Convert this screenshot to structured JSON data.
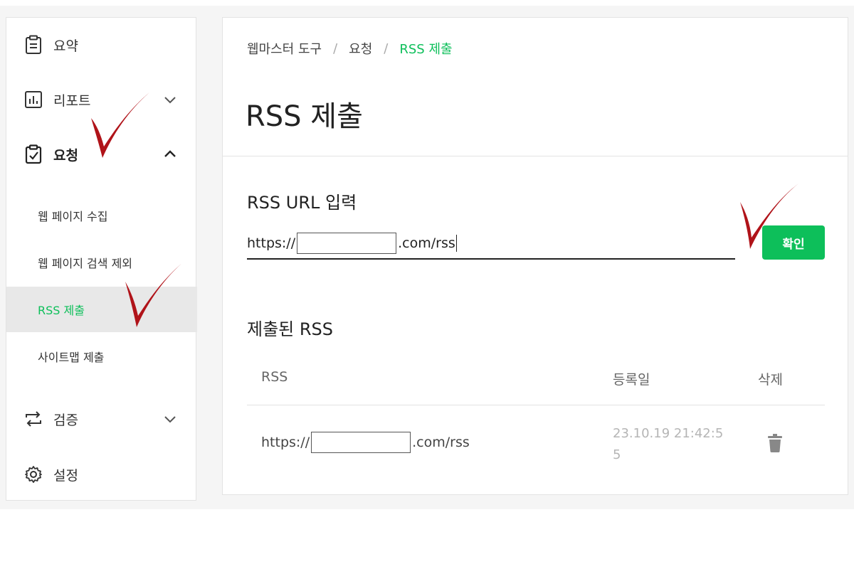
{
  "sidebar": {
    "items": [
      {
        "label": "요약",
        "icon": "clipboard-icon"
      },
      {
        "label": "리포트",
        "icon": "chart-icon"
      },
      {
        "label": "요청",
        "icon": "clipboard-check-icon"
      },
      {
        "label": "검증",
        "icon": "repeat-icon"
      },
      {
        "label": "설정",
        "icon": "gear-icon"
      }
    ],
    "sub_items": [
      {
        "label": "웹 페이지 수집"
      },
      {
        "label": "웹 페이지 검색 제외"
      },
      {
        "label": "RSS 제출"
      },
      {
        "label": "사이트맵 제출"
      }
    ]
  },
  "breadcrumb": {
    "root": "웹마스터 도구",
    "sep": "/",
    "parent": "요청",
    "current": "RSS 제출"
  },
  "page_title": "RSS 제출",
  "rss_input": {
    "title": "RSS URL 입력",
    "prefix": "https://",
    "suffix": ".com/rss"
  },
  "confirm_label": "확인",
  "submitted": {
    "title": "제출된 RSS",
    "headers": {
      "rss": "RSS",
      "date": "등록일",
      "delete": "삭제"
    },
    "rows": [
      {
        "prefix": "https://",
        "suffix": ".com/rss",
        "date": "23.10.19 21:42:55"
      }
    ]
  },
  "colors": {
    "accent": "#0dbf5a",
    "checkmark": "#b01319"
  }
}
